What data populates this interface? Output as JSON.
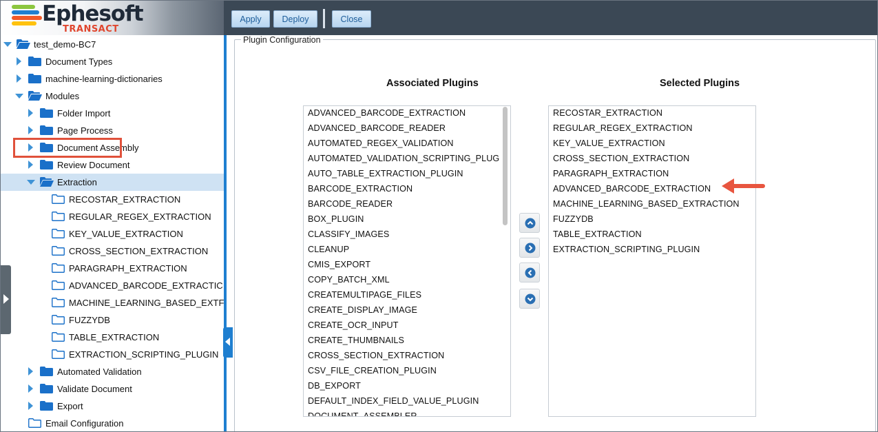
{
  "app": {
    "logo_text": "Ephesoft",
    "logo_sub": "TRANSACT",
    "colors": {
      "header_bg": "#3b4855",
      "accent_blue": "#1f7fd0",
      "highlight_red": "#e0513b",
      "folder_blue": "#1a70c9"
    }
  },
  "toolbar": {
    "apply_label": "Apply",
    "deploy_label": "Deploy",
    "close_label": "Close"
  },
  "tree": {
    "items": [
      {
        "label": "test_demo-BC7",
        "level": 0,
        "arrow": "down",
        "folder": "open"
      },
      {
        "label": "Document Types",
        "level": 1,
        "arrow": "right",
        "folder": "closed"
      },
      {
        "label": "machine-learning-dictionaries",
        "level": 1,
        "arrow": "right",
        "folder": "closed"
      },
      {
        "label": "Modules",
        "level": 1,
        "arrow": "down",
        "folder": "open"
      },
      {
        "label": "Folder Import",
        "level": 2,
        "arrow": "right",
        "folder": "closed"
      },
      {
        "label": "Page Process",
        "level": 2,
        "arrow": "right",
        "folder": "closed"
      },
      {
        "label": "Document Assembly",
        "level": 2,
        "arrow": "right",
        "folder": "closed"
      },
      {
        "label": "Review Document",
        "level": 2,
        "arrow": "right",
        "folder": "closed"
      },
      {
        "label": "Extraction",
        "level": 2,
        "arrow": "down",
        "folder": "open",
        "selected": true
      },
      {
        "label": "RECOSTAR_EXTRACTION",
        "level": 3,
        "arrow": "none",
        "folder": "outline"
      },
      {
        "label": "REGULAR_REGEX_EXTRACTION",
        "level": 3,
        "arrow": "none",
        "folder": "outline"
      },
      {
        "label": "KEY_VALUE_EXTRACTION",
        "level": 3,
        "arrow": "none",
        "folder": "outline"
      },
      {
        "label": "CROSS_SECTION_EXTRACTION",
        "level": 3,
        "arrow": "none",
        "folder": "outline"
      },
      {
        "label": "PARAGRAPH_EXTRACTION",
        "level": 3,
        "arrow": "none",
        "folder": "outline"
      },
      {
        "label": "ADVANCED_BARCODE_EXTRACTIC",
        "level": 3,
        "arrow": "none",
        "folder": "outline"
      },
      {
        "label": "MACHINE_LEARNING_BASED_EXTF",
        "level": 3,
        "arrow": "none",
        "folder": "outline"
      },
      {
        "label": "FUZZYDB",
        "level": 3,
        "arrow": "none",
        "folder": "outline"
      },
      {
        "label": "TABLE_EXTRACTION",
        "level": 3,
        "arrow": "none",
        "folder": "outline"
      },
      {
        "label": "EXTRACTION_SCRIPTING_PLUGIN",
        "level": 3,
        "arrow": "none",
        "folder": "outline"
      },
      {
        "label": "Automated Validation",
        "level": 2,
        "arrow": "right",
        "folder": "closed"
      },
      {
        "label": "Validate Document",
        "level": 2,
        "arrow": "right",
        "folder": "closed"
      },
      {
        "label": "Export",
        "level": 2,
        "arrow": "right",
        "folder": "closed"
      },
      {
        "label": "Email Configuration",
        "level": 1,
        "arrow": "none",
        "folder": "outline"
      }
    ]
  },
  "main": {
    "legend": "Plugin Configuration",
    "associated_title": "Associated Plugins",
    "selected_title": "Selected Plugins",
    "associated_plugins": [
      "ADVANCED_BARCODE_EXTRACTION",
      "ADVANCED_BARCODE_READER",
      "AUTOMATED_REGEX_VALIDATION",
      "AUTOMATED_VALIDATION_SCRIPTING_PLUG",
      "AUTO_TABLE_EXTRACTION_PLUGIN",
      "BARCODE_EXTRACTION",
      "BARCODE_READER",
      "BOX_PLUGIN",
      "CLASSIFY_IMAGES",
      "CLEANUP",
      "CMIS_EXPORT",
      "COPY_BATCH_XML",
      "CREATEMULTIPAGE_FILES",
      "CREATE_DISPLAY_IMAGE",
      "CREATE_OCR_INPUT",
      "CREATE_THUMBNAILS",
      "CROSS_SECTION_EXTRACTION",
      "CSV_FILE_CREATION_PLUGIN",
      "DB_EXPORT",
      "DEFAULT_INDEX_FIELD_VALUE_PLUGIN",
      "DOCUMENT_ASSEMBLER"
    ],
    "selected_plugins": [
      "RECOSTAR_EXTRACTION",
      "REGULAR_REGEX_EXTRACTION",
      "KEY_VALUE_EXTRACTION",
      "CROSS_SECTION_EXTRACTION",
      "PARAGRAPH_EXTRACTION",
      "ADVANCED_BARCODE_EXTRACTION",
      "MACHINE_LEARNING_BASED_EXTRACTION",
      "FUZZYDB",
      "TABLE_EXTRACTION",
      "EXTRACTION_SCRIPTING_PLUGIN"
    ],
    "move_buttons": [
      "move-up",
      "move-right",
      "move-left",
      "move-down"
    ]
  }
}
